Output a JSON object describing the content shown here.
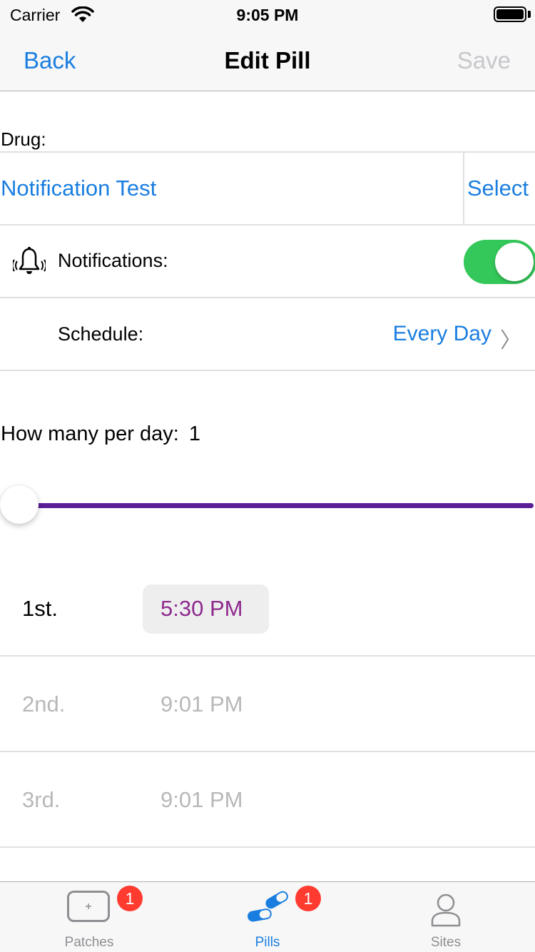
{
  "status_bar": {
    "carrier": "Carrier",
    "time": "9:05 PM"
  },
  "nav": {
    "back_label": "Back",
    "title": "Edit Pill",
    "save_label": "Save"
  },
  "drug": {
    "label": "Drug:",
    "name": "Notification Test",
    "select_label": "Select"
  },
  "notifications": {
    "label": "Notifications:",
    "enabled": true,
    "icon": "bell-icon"
  },
  "schedule": {
    "label": "Schedule:",
    "value": "Every Day"
  },
  "per_day": {
    "label": "How many per day:",
    "count": "1",
    "slider_value": 1,
    "slider_color": "#5a1e96"
  },
  "times": [
    {
      "ordinal": "1st.",
      "time": "5:30 PM",
      "active": true
    },
    {
      "ordinal": "2nd.",
      "time": "9:01 PM",
      "active": false
    },
    {
      "ordinal": "3rd.",
      "time": "9:01 PM",
      "active": false
    }
  ],
  "tab_bar": {
    "tabs": [
      {
        "label": "Patches",
        "badge": "1",
        "icon": "patch-icon",
        "active": false
      },
      {
        "label": "Pills",
        "badge": "1",
        "icon": "pill-icon",
        "active": true
      },
      {
        "label": "Sites",
        "icon": "person-icon",
        "active": false
      }
    ]
  },
  "colors": {
    "accent": "#1a7ee0",
    "toggle_on": "#34c759",
    "time_active": "#8e2a8e",
    "badge": "#ff3b30"
  }
}
